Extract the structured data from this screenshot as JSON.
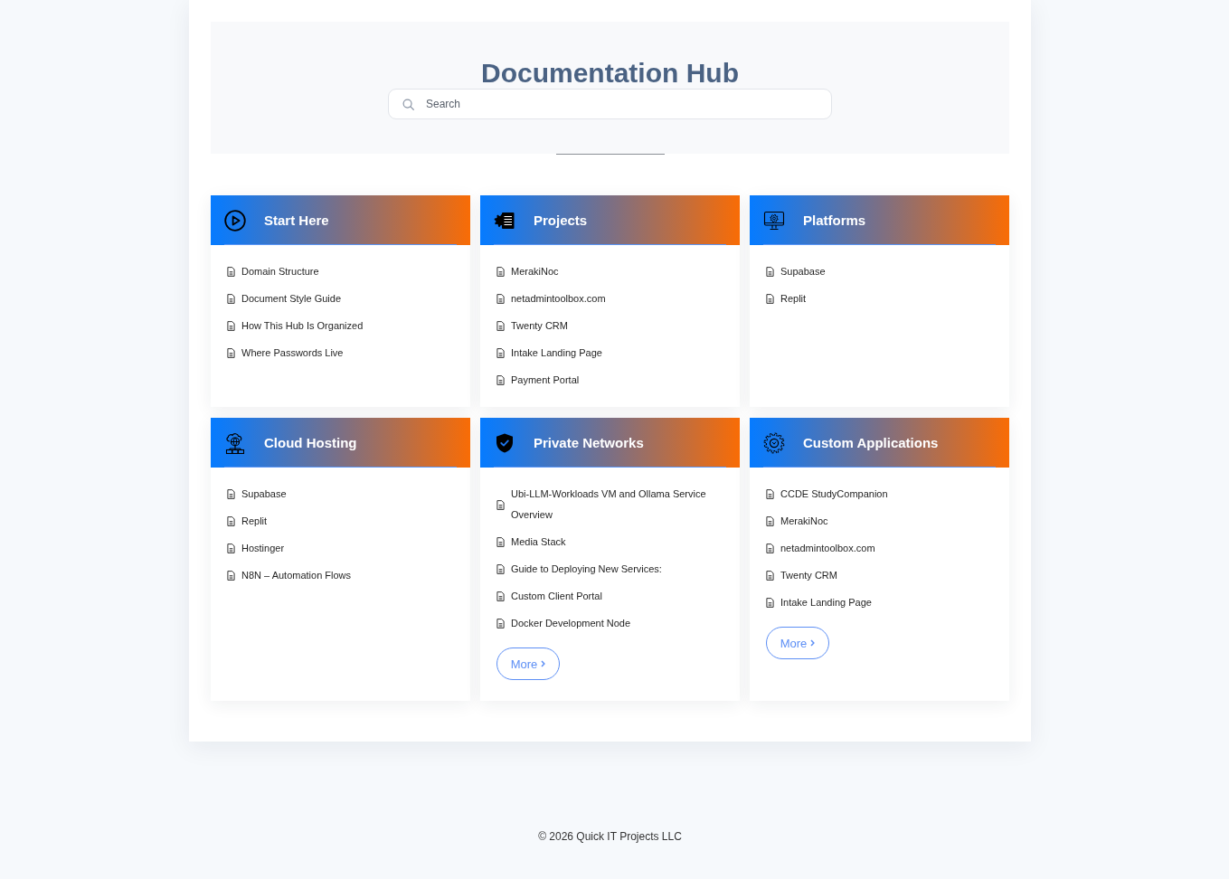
{
  "header": {
    "title": "Documentation Hub",
    "search": {
      "placeholder": "Search"
    }
  },
  "cards": [
    {
      "title": "Start Here",
      "items": [
        "Domain Structure",
        "Document Style Guide",
        "How This Hub Is Organized",
        "Where Passwords Live"
      ]
    },
    {
      "title": "Projects",
      "items": [
        "MerakiNoc",
        "netadmintoolbox.com",
        "Twenty CRM",
        "Intake Landing Page",
        "Payment Portal"
      ]
    },
    {
      "title": "Platforms",
      "items": [
        "Supabase",
        "Replit"
      ]
    },
    {
      "title": "Cloud Hosting",
      "items": [
        "Supabase",
        "Replit",
        "Hostinger",
        "N8N – Automation Flows"
      ]
    },
    {
      "title": "Private Networks",
      "items": [
        "Ubi-LLM-Workloads VM and Ollama Service Overview",
        "Media Stack",
        "Guide to Deploying New Services:",
        "Custom Client Portal",
        "Docker Development Node"
      ],
      "more_button": "More"
    },
    {
      "title": "Custom Applications",
      "items": [
        "CCDE StudyCompanion",
        "MerakiNoc",
        "netadmintoolbox.com",
        "Twenty CRM",
        "Intake Landing Page"
      ],
      "more_button": "More"
    }
  ],
  "footer": {
    "text": "© 2026 Quick IT Projects LLC"
  }
}
